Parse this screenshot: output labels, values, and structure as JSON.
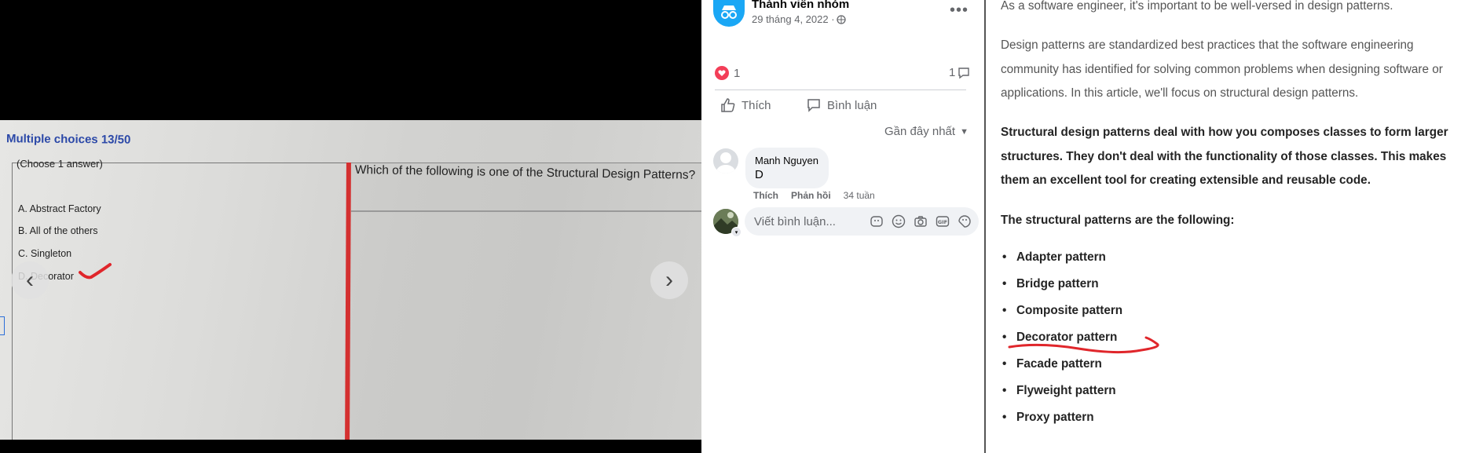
{
  "photo": {
    "title": "Multiple choices 13/50",
    "choose": "(Choose 1 answer)",
    "question": "Which of the following is one of the Structural Design Patterns?",
    "options": [
      "A.  Abstract Factory",
      "B.  All of the others",
      "C.  Singleton",
      "D.  Decorator"
    ]
  },
  "viewer": {
    "prev_icon": "chevron-left-icon",
    "next_icon": "chevron-right-icon"
  },
  "post": {
    "author": "Thành viên nhóm",
    "date": "29 tháng 4, 2022 · ",
    "reaction_count": "1",
    "comment_count": "1",
    "like_label": "Thích",
    "comment_label": "Bình luận",
    "sort_label": "Gần đây nhất"
  },
  "comment": {
    "author": "Manh Nguyen",
    "text": "D",
    "like": "Thích",
    "reply": "Phản hồi",
    "time": "34 tuần"
  },
  "composer": {
    "placeholder": "Viết bình luận..."
  },
  "article": {
    "p1": "As a software engineer, it's important to be well-versed in design patterns.",
    "p2": "Design patterns are standardized best practices that the software engineering community has identified for solving common problems when designing software or applications. In this article, we'll focus on structural design patterns.",
    "p3": "Structural design patterns deal with how you composes classes to form larger structures. They don't deal with the functionality of those classes. This makes them an excellent tool for creating extensible and reusable code.",
    "p4": "The structural patterns are the following:",
    "patterns": [
      "Adapter pattern",
      "Bridge pattern",
      "Composite pattern",
      "Decorator pattern",
      "Facade pattern",
      "Flyweight pattern",
      "Proxy pattern"
    ]
  },
  "colors": {
    "accent_red": "#e0262b",
    "link_blue": "#1877f2",
    "heart": "#f33e58"
  }
}
